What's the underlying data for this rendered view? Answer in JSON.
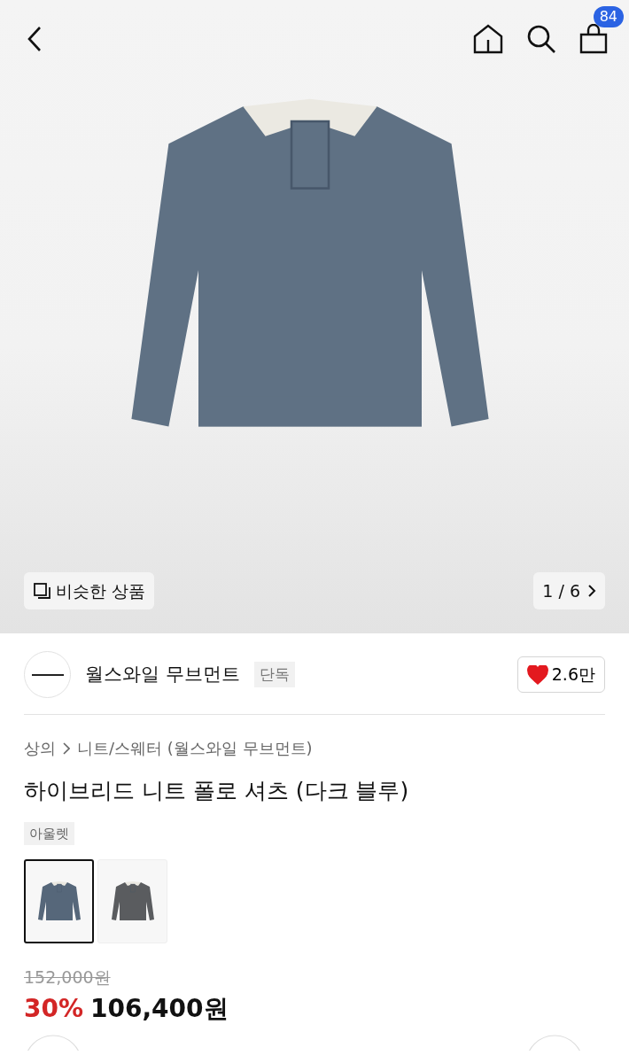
{
  "header": {
    "cart_count": "84"
  },
  "gallery": {
    "similar_label": "비슷한 상품",
    "counter": "1 / 6",
    "color": "#5f7184"
  },
  "brand": {
    "name": "월스와일 무브먼트",
    "tag": "단독",
    "likes": "2.6만",
    "liked": true
  },
  "breadcrumb": [
    "상의",
    "니트/스웨터 (월스와일 무브먼트)"
  ],
  "title": "하이브리드 니트 폴로 셔츠 (다크 블루)",
  "tags": [
    "아울렛"
  ],
  "thumbnails": [
    {
      "selected": true,
      "color": "#56677a"
    },
    {
      "selected": false,
      "color": "#5a5c5f"
    }
  ],
  "price": {
    "original": "152,000원",
    "discount": "30%",
    "sale": "106,400원"
  }
}
